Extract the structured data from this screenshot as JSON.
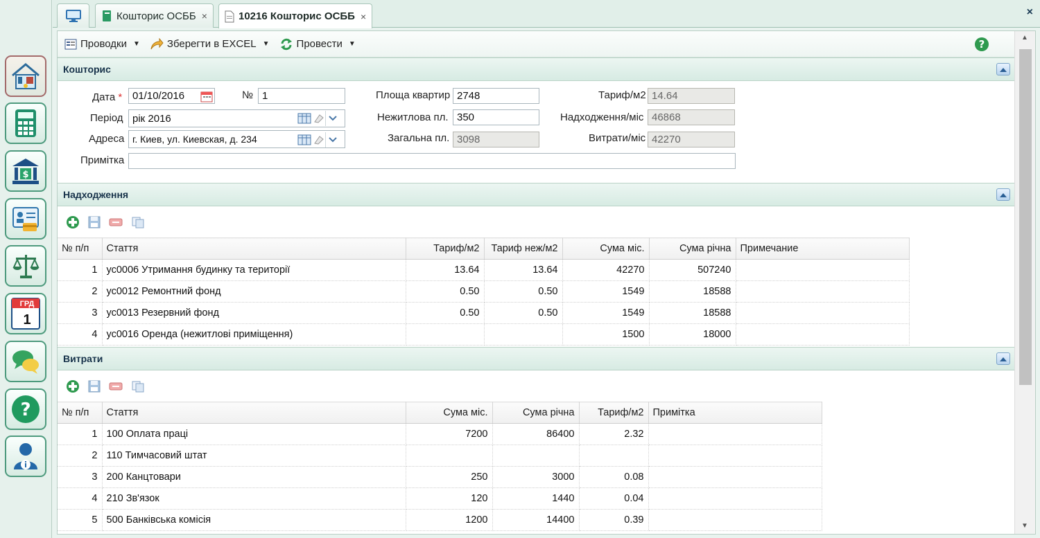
{
  "tabs": {
    "desktop_icon": "monitor-icon",
    "tab1": {
      "label": "Кошторис ОСББ"
    },
    "tab2": {
      "label": "10216 Кошторис ОСББ"
    },
    "close_symbol": "×"
  },
  "sidebar": [
    {
      "icon": "house-utilities-icon"
    },
    {
      "icon": "calculator-icon"
    },
    {
      "icon": "bank-icon"
    },
    {
      "icon": "id-card-icon"
    },
    {
      "icon": "scales-icon"
    },
    {
      "icon": "calendar-icon",
      "text_top": "ГРД",
      "text_num": "1"
    },
    {
      "icon": "chat-icon"
    },
    {
      "icon": "help-icon"
    },
    {
      "icon": "user-info-icon"
    }
  ],
  "toolbar": {
    "postings_label": "Проводки",
    "excel_label": "Зберегти в EXCEL",
    "post_label": "Провести"
  },
  "estimate": {
    "title": "Кошторис",
    "date_label": "Дата",
    "date_required": "*",
    "date_value": "01/10/2016",
    "number_label": "№",
    "number_value": "1",
    "period_label": "Період",
    "period_value": "рік 2016",
    "address_label": "Адреса",
    "address_value": "г. Киев, ул. Киевская, д. 234",
    "note_label": "Примітка",
    "note_value": "",
    "apt_area_label": "Площа квартир",
    "apt_area_value": "2748",
    "nonres_label": "Нежитлова пл.",
    "nonres_value": "350",
    "total_label": "Загальна пл.",
    "total_value": "3098",
    "tariff_label": "Тариф/м2",
    "tariff_value": "14.64",
    "income_month_label": "Надходження/міс",
    "income_month_value": "46868",
    "expense_month_label": "Витрати/міс",
    "expense_month_value": "42270"
  },
  "income": {
    "title": "Надходження",
    "columns": [
      "№ п/п",
      "Стаття",
      "Тариф/м2",
      "Тариф неж/м2",
      "Сума міс.",
      "Сума річна",
      "Примечание"
    ],
    "rows": [
      [
        "1",
        "ус0006 Утримання будинку та території",
        "13.64",
        "13.64",
        "42270",
        "507240",
        ""
      ],
      [
        "2",
        "ус0012 Ремонтний фонд",
        "0.50",
        "0.50",
        "1549",
        "18588",
        ""
      ],
      [
        "3",
        "ус0013 Резервний фонд",
        "0.50",
        "0.50",
        "1549",
        "18588",
        ""
      ],
      [
        "4",
        "ус0016 Оренда (нежитлові приміщення)",
        "",
        "",
        "1500",
        "18000",
        ""
      ]
    ]
  },
  "expenses": {
    "title": "Витрати",
    "columns": [
      "№ п/п",
      "Стаття",
      "Сума міс.",
      "Сума річна",
      "Тариф/м2",
      "Примітка"
    ],
    "rows": [
      [
        "1",
        "100 Оплата праці",
        "7200",
        "86400",
        "2.32",
        ""
      ],
      [
        "2",
        "110 Тимчасовий штат",
        "",
        "",
        "",
        ""
      ],
      [
        "3",
        "200 Канцтовари",
        "250",
        "3000",
        "0.08",
        ""
      ],
      [
        "4",
        "210 Зв'язок",
        "120",
        "1440",
        "0.04",
        ""
      ],
      [
        "5",
        "500 Банківська комісія",
        "1200",
        "14400",
        "0.39",
        ""
      ]
    ]
  }
}
